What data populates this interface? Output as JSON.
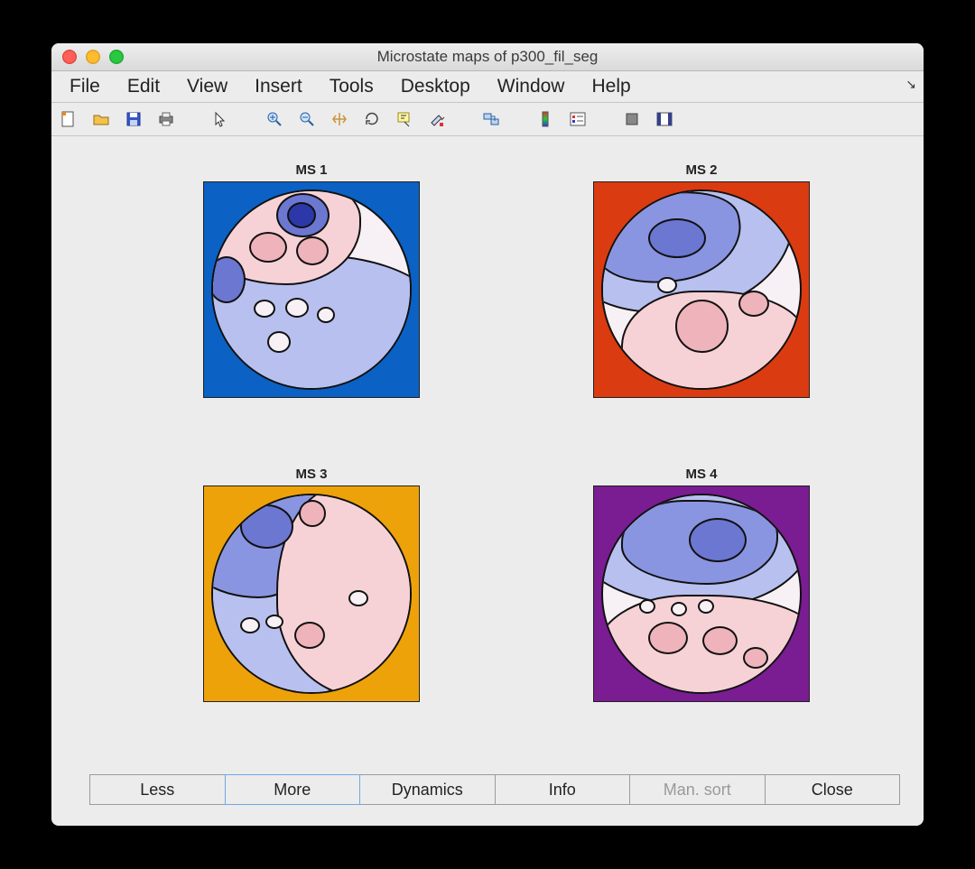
{
  "window": {
    "title": "Microstate maps of p300_fil_seg"
  },
  "menu": {
    "items": [
      "File",
      "Edit",
      "View",
      "Insert",
      "Tools",
      "Desktop",
      "Window",
      "Help"
    ],
    "corner_glyph": "↘"
  },
  "toolbar": {
    "items": [
      "new-figure-icon",
      "open-icon",
      "save-icon",
      "print-icon",
      "pointer-icon",
      "zoom-in-icon",
      "zoom-out-icon",
      "pan-icon",
      "rotate-icon",
      "data-cursor-icon",
      "brush-icon",
      "link-icon",
      "colorbar-icon",
      "legend-icon",
      "hide-icon",
      "show-plot-tools-icon"
    ]
  },
  "plots": {
    "ms1": {
      "title": "MS 1",
      "bg_color": "#0b61c4"
    },
    "ms2": {
      "title": "MS 2",
      "bg_color": "#db3b11"
    },
    "ms3": {
      "title": "MS 3",
      "bg_color": "#eea20a"
    },
    "ms4": {
      "title": "MS 4",
      "bg_color": "#7a1c92"
    }
  },
  "buttons": {
    "less": {
      "label": "Less",
      "state": "normal"
    },
    "more": {
      "label": "More",
      "state": "active"
    },
    "dynamics": {
      "label": "Dynamics",
      "state": "normal"
    },
    "info": {
      "label": "Info",
      "state": "normal"
    },
    "man_sort": {
      "label": "Man. sort",
      "state": "disabled"
    },
    "close": {
      "label": "Close",
      "state": "normal"
    }
  },
  "colors": {
    "window_bg": "#ececec",
    "head_fill": "#f7f0f4",
    "contour_blue_light": "#b7c0ee",
    "contour_blue_dark": "#6b77d1",
    "contour_pink_light": "#f6d2d6",
    "contour_pink_dark": "#efb3bb"
  }
}
